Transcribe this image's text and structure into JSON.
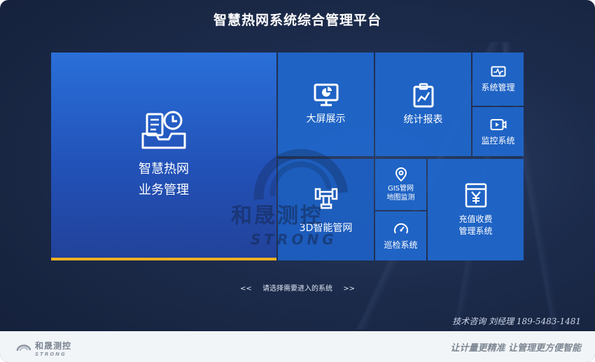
{
  "header": {
    "title": "智慧热网系统综合管理平台"
  },
  "tiles": {
    "business": {
      "line1": "智慧热网",
      "line2": "业务管理"
    },
    "bigscreen": {
      "label": "大屏展示"
    },
    "report": {
      "label": "统计报表"
    },
    "sysmgmt": {
      "label": "系统管理"
    },
    "monitor": {
      "label": "监控系统"
    },
    "pipe3d": {
      "label": "3D智能管网"
    },
    "gis": {
      "line1": "GIS管网",
      "line2": "地图监测"
    },
    "billing": {
      "line1": "充值收费",
      "line2": "管理系统"
    },
    "patrol": {
      "label": "巡检系统"
    }
  },
  "watermark": {
    "cn": "和晟测控",
    "en": "STRONG"
  },
  "hint": {
    "prev": "<<",
    "text": "请选择需要进入的系统",
    "next": ">>"
  },
  "consult": {
    "text": "技术咨询  刘经理  189-5483-1481"
  },
  "footer": {
    "logo_cn": "和晟测控",
    "logo_en": "STRONG",
    "slogan": "让计量更精准 让管理更方便智能"
  },
  "colors": {
    "accent_bar": "#f2b021",
    "tile_blue": "#1f67cd",
    "background": "#1c2b4b"
  }
}
